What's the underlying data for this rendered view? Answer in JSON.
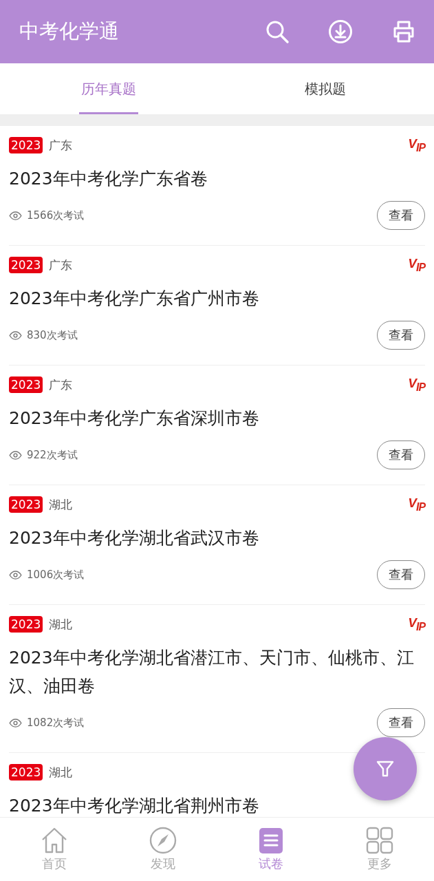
{
  "app_bar": {
    "title": "中考化学通"
  },
  "tabs": [
    {
      "label": "历年真题",
      "selected": true
    },
    {
      "label": "模拟题",
      "selected": false
    }
  ],
  "papers": [
    {
      "year": "2023",
      "region": "广东",
      "vip_mark": "V$_{IP}$",
      "title": "2023年中考化学广东省卷",
      "views": "1566次考试",
      "button": "查看"
    },
    {
      "year": "2023",
      "region": "广东",
      "vip_mark": "V$_{IP}$",
      "title": "2023年中考化学广东省广州市卷",
      "views": "830次考试",
      "button": "查看"
    },
    {
      "year": "2023",
      "region": "广东",
      "vip_mark": "V$_{IP}$",
      "title": "2023年中考化学广东省深圳市卷",
      "views": "922次考试",
      "button": "查看"
    },
    {
      "year": "2023",
      "region": "湖北",
      "vip_mark": "V$_{IP}$",
      "title": "2023年中考化学湖北省武汉市卷",
      "views": "1006次考试",
      "button": "查看"
    },
    {
      "year": "2023",
      "region": "湖北",
      "vip_mark": "V$_{IP}$",
      "title": "2023年中考化学湖北省潜江市、天门市、仙桃市、江汉、油田卷",
      "views": "1082次考试",
      "button": "查看"
    },
    {
      "year": "2023",
      "region": "湖北",
      "title": "2023年中考化学湖北省荆州市卷"
    }
  ],
  "bottom_nav": [
    {
      "label": "首页",
      "kind": "home",
      "selected": false
    },
    {
      "label": "发现",
      "kind": "compass",
      "selected": false
    },
    {
      "label": "试卷",
      "kind": "paper",
      "selected": true
    },
    {
      "label": "更多",
      "kind": "grid",
      "selected": false
    }
  ]
}
